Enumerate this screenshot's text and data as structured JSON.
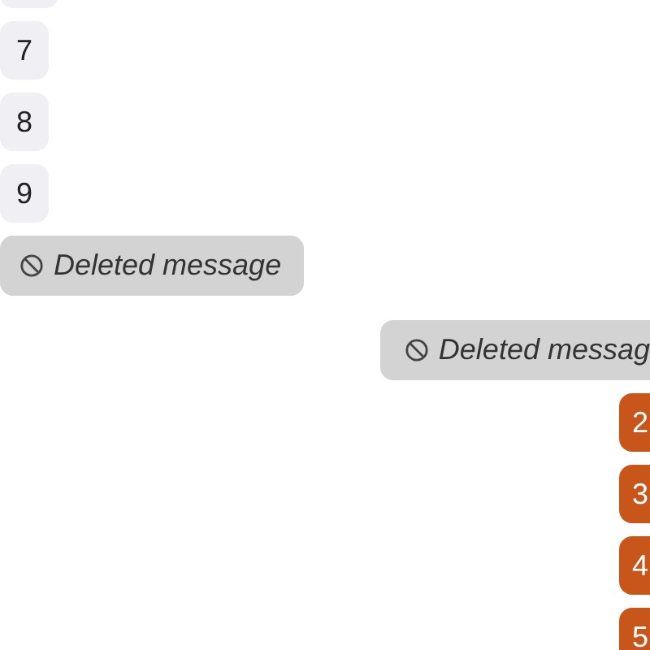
{
  "messages": [
    {
      "outgoing": false,
      "kind": "cut"
    },
    {
      "outgoing": false,
      "kind": "text",
      "text": "7"
    },
    {
      "outgoing": false,
      "kind": "text",
      "text": "8"
    },
    {
      "outgoing": false,
      "kind": "text",
      "text": "9"
    },
    {
      "outgoing": false,
      "kind": "deleted",
      "text": "Deleted message"
    },
    {
      "outgoing": true,
      "kind": "deleted",
      "text": "Deleted messag"
    },
    {
      "outgoing": true,
      "kind": "text",
      "text": "2"
    },
    {
      "outgoing": true,
      "kind": "text",
      "text": "3"
    },
    {
      "outgoing": true,
      "kind": "text",
      "text": "4"
    },
    {
      "outgoing": true,
      "kind": "text",
      "text": "5"
    }
  ]
}
